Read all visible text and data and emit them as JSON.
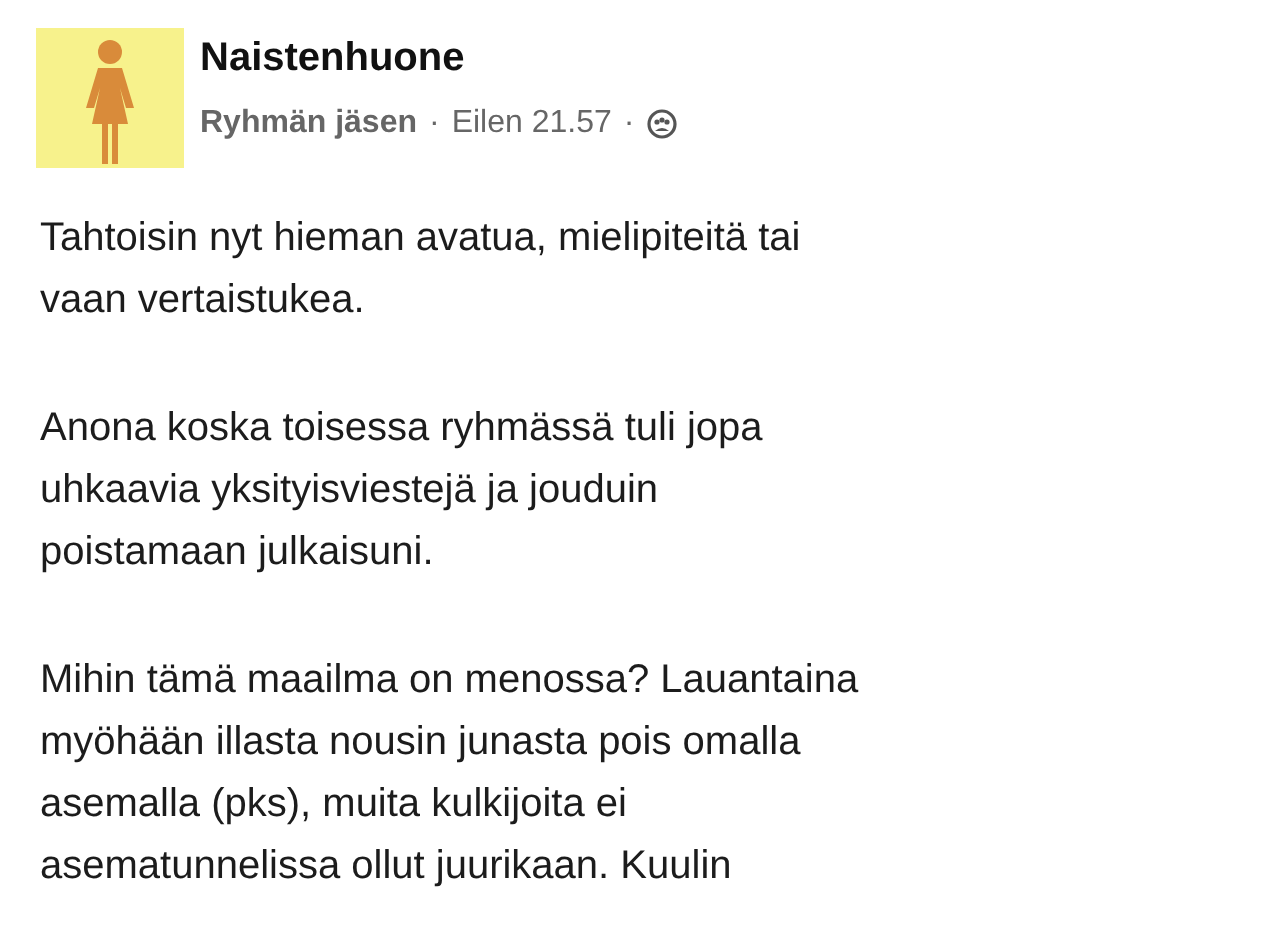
{
  "post": {
    "group_name": "Naistenhuone",
    "author_role": "Ryhmän jäsen",
    "separator_1": "·",
    "time": "Eilen 21.57",
    "separator_2": "·",
    "paragraphs": [
      [
        "Tahtoisin nyt hieman avatua, mielipiteitä tai",
        "vaan vertaistukea."
      ],
      [
        "Anona koska toisessa ryhmässä tuli jopa",
        "uhkaavia yksityisviestejä ja jouduin",
        "poistamaan julkaisuni."
      ],
      [
        "Mihin tämä maailma on menossa? Lauantaina",
        "myöhään illasta nousin junasta pois omalla",
        "asemalla (pks), muita kulkijoita ei",
        "asematunnelissa ollut juurikaan. Kuulin"
      ]
    ]
  }
}
